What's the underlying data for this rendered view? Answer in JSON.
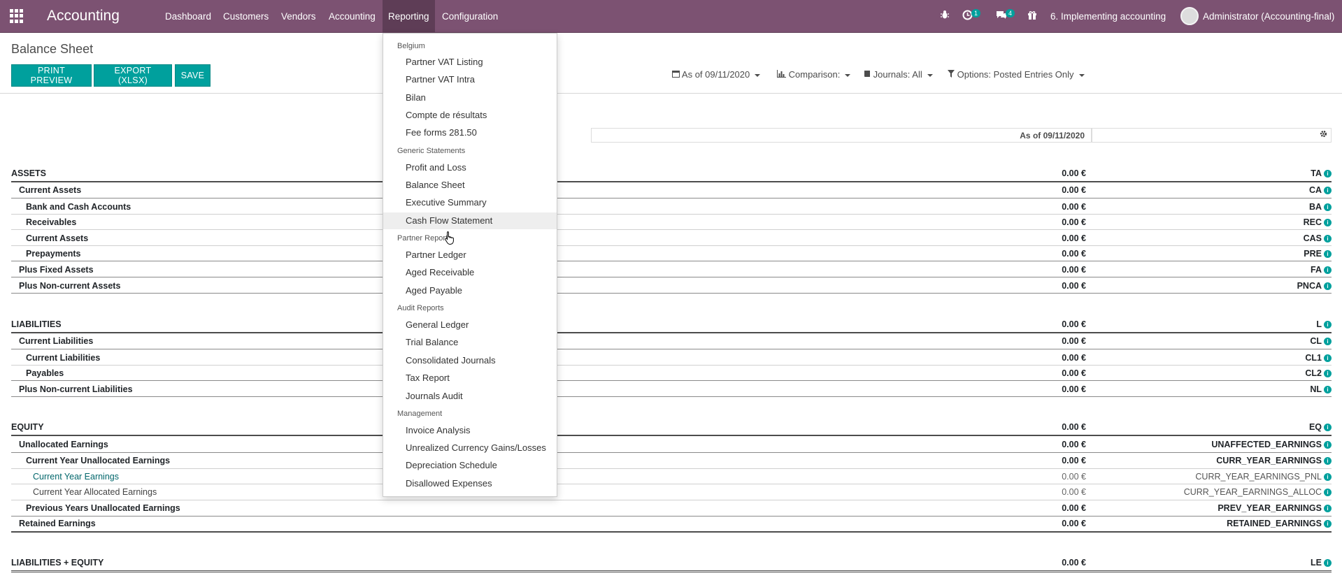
{
  "navbar": {
    "brand": "Accounting",
    "menu": [
      "Dashboard",
      "Customers",
      "Vendors",
      "Accounting",
      "Reporting",
      "Configuration"
    ],
    "activities_count": "1",
    "messages_count": "4",
    "company": "6. Implementing accounting",
    "user": "Administrator (Accounting-final)"
  },
  "page": {
    "title": "Balance Sheet",
    "buttons": [
      "PRINT PREVIEW",
      "EXPORT (XLSX)",
      "SAVE"
    ],
    "filters": {
      "date": "As of 09/11/2020",
      "comparison": "Comparison:",
      "journals": "Journals: All",
      "options": "Options: Posted Entries Only"
    },
    "column_header": "As of 09/11/2020"
  },
  "report": {
    "rows": [
      {
        "label": "ASSETS",
        "amount": "0.00 €",
        "code": "TA"
      },
      {
        "label": "Current Assets",
        "amount": "0.00 €",
        "code": "CA"
      },
      {
        "label": "Bank and Cash Accounts",
        "amount": "0.00 €",
        "code": "BA"
      },
      {
        "label": "Receivables",
        "amount": "0.00 €",
        "code": "REC"
      },
      {
        "label": "Current Assets",
        "amount": "0.00 €",
        "code": "CAS"
      },
      {
        "label": "Prepayments",
        "amount": "0.00 €",
        "code": "PRE"
      },
      {
        "label": "Plus Fixed Assets",
        "amount": "0.00 €",
        "code": "FA"
      },
      {
        "label": "Plus Non-current Assets",
        "amount": "0.00 €",
        "code": "PNCA"
      },
      {
        "label": "LIABILITIES",
        "amount": "0.00 €",
        "code": "L"
      },
      {
        "label": "Current Liabilities",
        "amount": "0.00 €",
        "code": "CL"
      },
      {
        "label": "Current Liabilities",
        "amount": "0.00 €",
        "code": "CL1"
      },
      {
        "label": "Payables",
        "amount": "0.00 €",
        "code": "CL2"
      },
      {
        "label": "Plus Non-current Liabilities",
        "amount": "0.00 €",
        "code": "NL"
      },
      {
        "label": "EQUITY",
        "amount": "0.00 €",
        "code": "EQ"
      },
      {
        "label": "Unallocated Earnings",
        "amount": "0.00 €",
        "code": "UNAFFECTED_EARNINGS"
      },
      {
        "label": "Current Year Unallocated Earnings",
        "amount": "0.00 €",
        "code": "CURR_YEAR_EARNINGS"
      },
      {
        "label": "Current Year Earnings",
        "amount": "0.00 €",
        "code": "CURR_YEAR_EARNINGS_PNL"
      },
      {
        "label": "Current Year Allocated Earnings",
        "amount": "0.00 €",
        "code": "CURR_YEAR_EARNINGS_ALLOC"
      },
      {
        "label": "Previous Years Unallocated Earnings",
        "amount": "0.00 €",
        "code": "PREV_YEAR_EARNINGS"
      },
      {
        "label": "Retained Earnings",
        "amount": "0.00 €",
        "code": "RETAINED_EARNINGS"
      },
      {
        "label": "LIABILITIES + EQUITY",
        "amount": "0.00 €",
        "code": "LE"
      }
    ]
  },
  "reporting_menu": {
    "sections": [
      "Belgium",
      "Generic Statements",
      "Partner Reports",
      "Audit Reports",
      "Management"
    ],
    "items": [
      "Partner VAT Listing",
      "Partner VAT Intra",
      "Bilan",
      "Compte de résultats",
      "Fee forms 281.50",
      "Profit and Loss",
      "Balance Sheet",
      "Executive Summary",
      "Cash Flow Statement",
      "Partner Ledger",
      "Aged Receivable",
      "Aged Payable",
      "General Ledger",
      "Trial Balance",
      "Consolidated Journals",
      "Tax Report",
      "Journals Audit",
      "Invoice Analysis",
      "Unrealized Currency Gains/Losses",
      "Depreciation Schedule",
      "Disallowed Expenses"
    ]
  }
}
